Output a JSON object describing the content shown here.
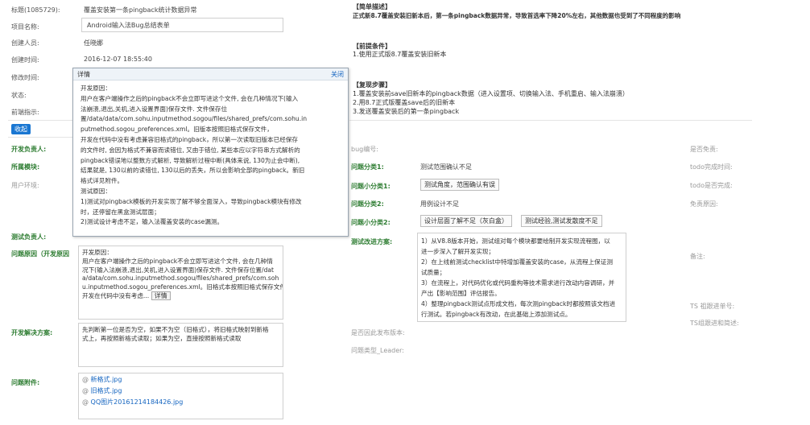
{
  "header": {
    "title_label": "标题(1085729):",
    "title_value": "覆盖安装第一条pingback统计数据异常"
  },
  "fields": {
    "project_label": "项目名称:",
    "project_value": "Android输入法Bug总结表单",
    "creator_label": "创建人员:",
    "creator_value": "任晓娜",
    "created_label": "创建时间:",
    "created_value": "2016-12-07 18:55:40",
    "modified_label": "修改时间:",
    "status_label": "状态:",
    "hint_label": "前端指示:",
    "collapse_label": "收起"
  },
  "popup": {
    "title": "详情",
    "close": "关闭",
    "lines": [
      "开发原因：",
      "用户在客户端操作之后的pingback不会立即写进这个文件, 会在几种情况下(输入",
      "法崩溃,退出,关机,进入设置界面)保存文件. 文件保存位",
      "置/data/data/com.sohu.inputmethod.sogou/files/shared_prefs/com.sohu.in",
      "putmethod.sogou_preferences.xml。旧版本按照旧格式保存文件，",
      "开发在代码中没有考虑兼容旧格式的pingback，所以第一次读取旧版本已经保存",
      "的文件时, 会因为格式不兼容而读错位, 又由于错位, 某些本应以字符串方式解析的",
      "pingback错误地以整数方式解析, 导致解析过程中断(具体来说, 130为止会中断),",
      "结果就是, 130以前的读错位, 130以后的丢失，所以会影响全部的pingback。新旧",
      "格式详见附件。",
      "测试原因：",
      "1)测试对pingback模板的开发实现了解不够全面深入，导致pingback模块有修改",
      "时，还停留在黑盒测试层面；",
      "2)测试设计考虑不足，输入法覆盖安装的case漏测。"
    ]
  },
  "right_top": {
    "brief_title": "【简单描述】",
    "brief_text": "正式新8.7覆盖安装旧新本后，第一条pingback数据异常，导致首选率下降20%左右，其他数据也受到了不同程度的影响",
    "pre_title": "【前提条件】",
    "pre_text": "1.使用正式版8.7覆盖安装旧新本",
    "steps_title": "【复现步骤】",
    "steps": [
      "1.覆盖安装前save旧新本的pingback数据（进入设置项、切换输入法、手机重启、输入法崩溃）",
      "2.用8.7正式版覆盖save后的旧新本",
      "3.发送覆盖安装后的第一条pingback"
    ]
  },
  "left_fields": {
    "dev_owner": "开发负责人:",
    "module": "所属模块:",
    "env": "用户环境:",
    "test_owner": "测试负责人:",
    "cause_label": "问题原因（开发原因",
    "solution_label": "开发解决方案:",
    "attach_label": "问题附件:"
  },
  "cause_box": {
    "lines": [
      "开发原因：",
      "用户在客户端操作之后的pingback不会立即写进这个文件, 会在几种情",
      "况下(输入法崩溃,退出,关机,进入设置界面)保存文件. 文件保存位置/dat",
      "a/data/com.sohu.inputmethod.sogou/files/shared_prefs/com.soh",
      "u.inputmethod.sogou_preferences.xml。旧格式本按照旧格式保存文件，",
      "开发在代码中没有考虑..."
    ],
    "detail_btn": "详情"
  },
  "solution_box": {
    "lines": [
      "先判断第一位是否为空，如果不为空（旧格式），将旧格式映射到新格",
      "式上，再按照新格式读取；如果为空，直接按照新格式读取"
    ]
  },
  "attachments": [
    "新格式.jpg",
    "旧格式.jpg",
    "QQ图片20161214184426.jpg"
  ],
  "middle": {
    "bug_no": "bug编号:",
    "class1_label": "问题分类1:",
    "class1_value": "测试范围确认不足",
    "subclass1_label": "问题小分类1:",
    "subclass1_tags": [
      "测试角度，范围确认有误"
    ],
    "class2_label": "问题分类2:",
    "class2_value": "用例设计不足",
    "subclass2_label": "问题小分类2:",
    "subclass2_tags": [
      "设计层面了解不足（灰白盒）",
      "测试经验,测试发散度不足"
    ],
    "improve_label": "测试改进方案:",
    "improve_lines": [
      "1）从V8.8版本开始，测试组对每个模块都要绘制开发实现流程图，以",
      "进一步深入了解开发实现；",
      "2）在上线前测试checklist中特增加覆盖安装的case，从流程上保证测",
      "试质量；",
      "3）在流程上，对代码优化或代码重构等技术需求进行改动内容调研，并",
      "产出【影响范围】评估报告。",
      "4）整理pingback测试点形成文档，每次测pingback时都按照该文档进",
      "行测试。若pingback有改动，在此基础上添加测试点。"
    ],
    "release_label": "是否因此发布版本:",
    "leader_label": "问题类型_Leader:"
  },
  "right_side": {
    "exempt": "是否免责:",
    "todo_time": "todo完成时间:",
    "todo_done": "todo是否完成:",
    "exempt_reason": "免责原因:",
    "remark": "备注:",
    "ts_ticket": "TS 祖跟进单号:",
    "ts_brief": "TS组跟进和简述:"
  }
}
